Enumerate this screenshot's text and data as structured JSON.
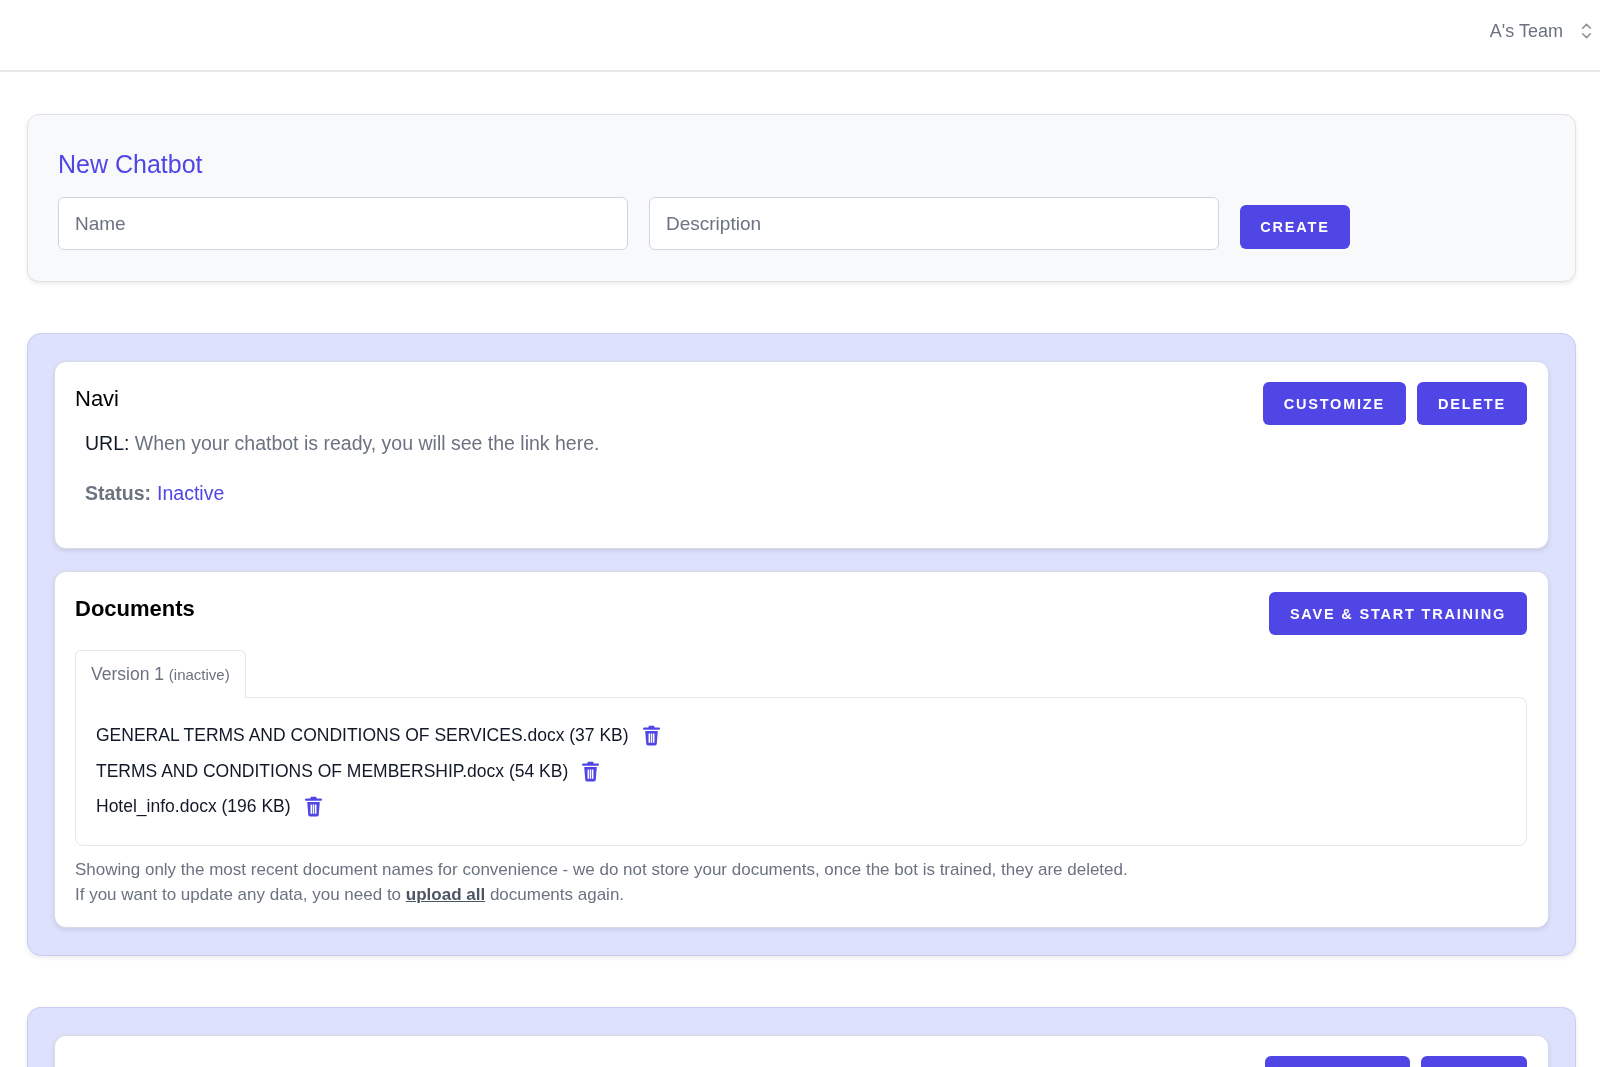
{
  "header": {
    "team_name": "A's Team"
  },
  "new_chatbot": {
    "title": "New Chatbot",
    "name_field": {
      "placeholder": "Name"
    },
    "description_field": {
      "placeholder": "Description"
    },
    "create_button": "CREATE"
  },
  "chatbots": [
    {
      "kind": "full",
      "name": "Navi",
      "buttons": [
        "CUSTOMIZE",
        "DELETE"
      ],
      "url_label": "URL:",
      "url_text": "When your chatbot is ready, you will see the link here.",
      "status_label": "Status:",
      "status_value": "Inactive",
      "status_active": false,
      "documents": {
        "title": "Documents",
        "train_button": "SAVE & START TRAINING",
        "tabs": [
          {
            "label": "Version 1",
            "note": "(inactive)",
            "selected": true
          }
        ],
        "files": [
          {
            "name": "GENERAL TERMS AND CONDITIONS OF SERVICES.docx (37 KB)"
          },
          {
            "name": "TERMS AND CONDITIONS OF MEMBERSHIP.docx (54 KB)"
          },
          {
            "name": "Hotel_info.docx (196 KB)"
          }
        ],
        "notes": [
          {
            "text": "Showing only the most recent document names for convenience - we do not store your documents, once the bot is trained, they are deleted."
          },
          {
            "text": "If you want to update any data, you need to",
            "link": "upload all",
            "after": "documents again."
          }
        ]
      }
    },
    {
      "kind": "cut_off"
    }
  ]
}
